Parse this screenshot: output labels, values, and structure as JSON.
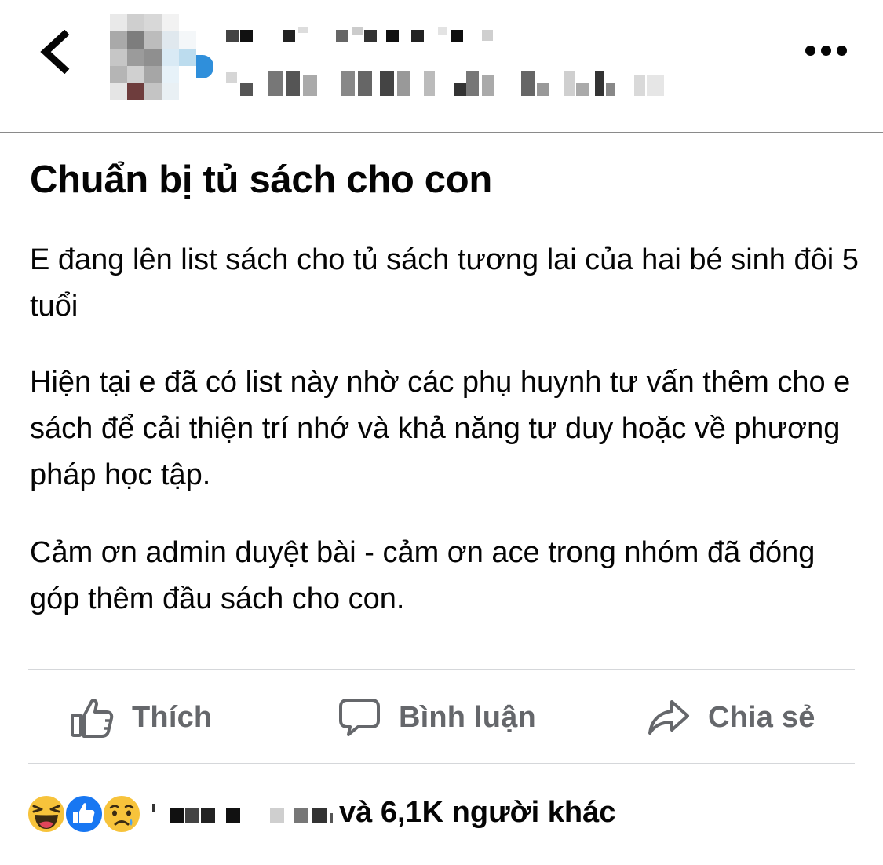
{
  "header": {
    "back_icon": "chevron-left-icon",
    "more_icon": "more-horizontal-icon"
  },
  "post": {
    "title": "Chuẩn bị tủ sách cho con",
    "paragraphs": [
      "E đang lên list sách cho tủ sách tương lai của hai bé sinh đôi 5 tuổi",
      "Hiện tại e đã có list này nhờ các phụ huynh tư vấn thêm cho e sách để cải thiện trí nhớ và khả năng tư duy hoặc về phương pháp học tập.",
      "Cảm ơn admin duyệt bài - cảm ơn ace trong nhóm đã đóng góp thêm đầu sách cho con."
    ]
  },
  "actions": {
    "like_label": "Thích",
    "comment_label": "Bình luận",
    "share_label": "Chia sẻ",
    "like_icon": "thumbs-up-icon",
    "comment_icon": "comment-bubble-icon",
    "share_icon": "share-arrow-icon"
  },
  "reactions": {
    "icons": [
      "haha-reaction-icon",
      "like-reaction-icon",
      "sad-reaction-icon"
    ],
    "summary": "và 6,1K người khác"
  },
  "colors": {
    "text": "#050505",
    "secondary_text": "#65676b",
    "divider": "#d5d7da",
    "like_blue": "#1877f2",
    "reaction_yellow": "#f7c33b"
  }
}
